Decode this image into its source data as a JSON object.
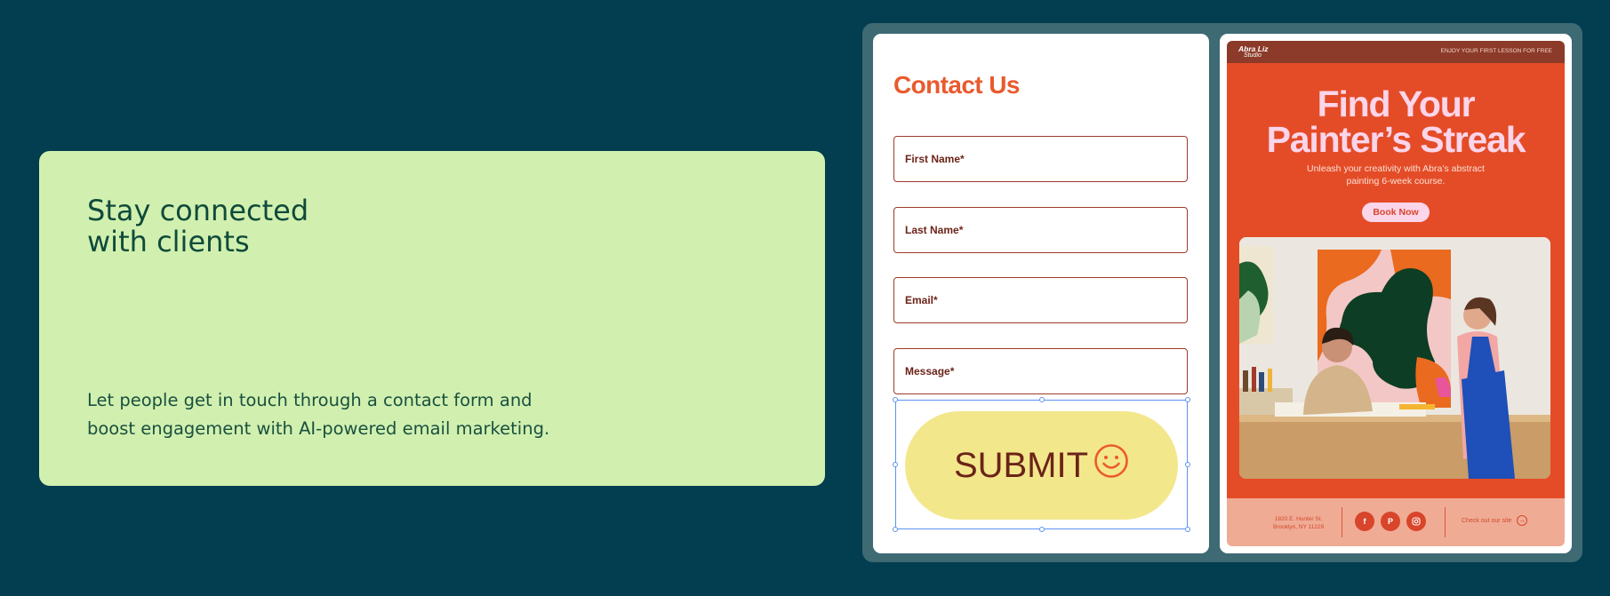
{
  "info": {
    "title": "Stay connected with clients",
    "description": "Let people get in touch through a contact form and boost engagement with AI-powered email marketing."
  },
  "form": {
    "title": "Contact Us",
    "fields": [
      {
        "label": "First Name*"
      },
      {
        "label": "Last Name*"
      },
      {
        "label": "Email*"
      },
      {
        "label": "Message*"
      }
    ],
    "submit_label": "SUBMIT"
  },
  "email": {
    "brand_main": "Abra Liz",
    "brand_sub": "Studio",
    "topbar_text": "ENJOY YOUR FIRST LESSON FOR FREE",
    "hero_title_line1": "Find Your",
    "hero_title_line2": "Painter’s Streak",
    "hero_subtitle": "Unleash your creativity with Abra’s abstract painting 6-week course.",
    "cta_label": "Book Now",
    "address_line1": "1820 E. Hunter St.",
    "address_line2": "Brooklyn, NY 11229",
    "site_link": "Check out our site"
  },
  "colors": {
    "background": "#033d50",
    "card_green": "#d1f0af",
    "accent_orange": "#e85b2e",
    "submit_yellow": "#f3e78c",
    "hero_red": "#e44c27",
    "pink": "#fbd5ea"
  },
  "icons": {
    "submit": "smiley-icon",
    "socials": [
      "facebook-icon",
      "pinterest-icon",
      "instagram-icon"
    ],
    "site": "arrow-right-icon"
  }
}
